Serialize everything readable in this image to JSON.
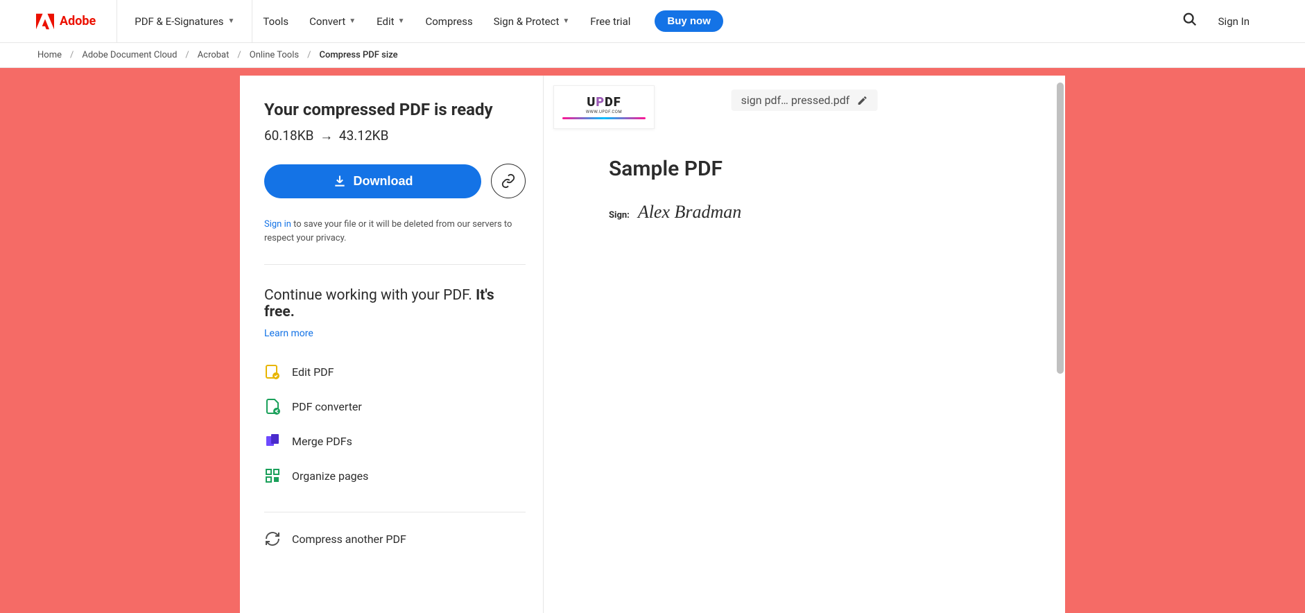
{
  "header": {
    "brand": "Adobe",
    "mainNav": "PDF & E-Signatures",
    "navItems": [
      "Tools",
      "Convert",
      "Edit",
      "Compress",
      "Sign & Protect",
      "Free trial"
    ],
    "buyNow": "Buy now",
    "signIn": "Sign In"
  },
  "breadcrumb": {
    "items": [
      "Home",
      "Adobe Document Cloud",
      "Acrobat",
      "Online Tools"
    ],
    "current": "Compress PDF size"
  },
  "leftPanel": {
    "title": "Your compressed PDF is ready",
    "sizeBefore": "60.18KB",
    "sizeAfter": "43.12KB",
    "downloadLabel": "Download",
    "signInLabel": "Sign in",
    "signInMsg": " to save your file or it will be deleted from our servers to respect your privacy.",
    "continueTitle": "Continue working with your PDF. ",
    "continueBold": "It's free.",
    "learnMore": "Learn more",
    "tools": [
      {
        "label": "Edit PDF"
      },
      {
        "label": "PDF converter"
      },
      {
        "label": "Merge PDFs"
      },
      {
        "label": "Organize pages"
      }
    ],
    "compressAnother": "Compress another PDF"
  },
  "rightPanel": {
    "fileName": "sign pdf… pressed.pdf",
    "pdfTitle": "Sample PDF",
    "signLabel": "Sign:",
    "signName": "Alex Bradman",
    "updfLabel": "UPDF",
    "updfUrl": "WWW.UPDF.COM"
  }
}
